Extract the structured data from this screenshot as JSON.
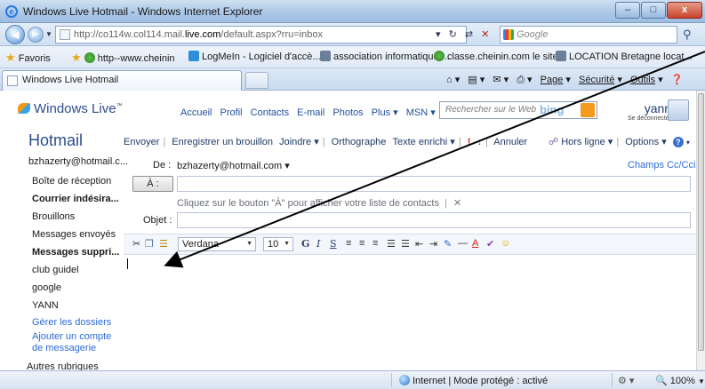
{
  "window": {
    "title": "Windows Live Hotmail - Windows Internet Explorer",
    "min": "–",
    "max": "□",
    "close": "x"
  },
  "address": {
    "url_prefix": "http://co114w.col114.mail.",
    "url_domain": "live.com",
    "url_suffix": "/default.aspx?rru=inbox",
    "search_placeholder": "Google",
    "back_icon": "back-arrow-icon",
    "forward_icon": "forward-arrow-icon"
  },
  "favorites": {
    "label": "Favoris",
    "items": [
      "http--www.cheinin",
      "LogMeIn - Logiciel d'accè...",
      "association informatique ...",
      "classe.cheinin.com  le site...",
      "LOCATION Bretagne locat..."
    ]
  },
  "tabs": {
    "active": "Windows Live Hotmail",
    "page": "Page",
    "security": "Sécurité",
    "tools": "Outils"
  },
  "header": {
    "brand": "Windows Live",
    "nav": [
      "Accueil",
      "Profil",
      "Contacts",
      "E-mail",
      "Photos",
      "Plus ▾",
      "MSN ▾"
    ],
    "search_placeholder": "Rechercher sur le Web",
    "search_engine": "bing",
    "user_name": "yann",
    "user_sub": "Se déconnecter"
  },
  "app": {
    "title": "Hotmail",
    "toolbar": [
      "Envoyer",
      "Enregistrer un brouillon",
      "Joindre ▾",
      "Orthographe",
      "Texte enrichi ▾",
      "Annuler"
    ],
    "offline": "Hors ligne ▾",
    "options": "Options ▾"
  },
  "sidebar": {
    "account": "bzhazerty@hotmail.c...",
    "items": [
      {
        "label": "Boîte de réception",
        "style": "normal"
      },
      {
        "label": "Courrier indésira...",
        "style": "bold"
      },
      {
        "label": "Brouillons",
        "style": "normal"
      },
      {
        "label": "Messages envoyés",
        "style": "normal"
      },
      {
        "label": "Messages suppri...",
        "style": "bold"
      },
      {
        "label": "club guidel",
        "style": "normal"
      },
      {
        "label": "google",
        "style": "normal"
      },
      {
        "label": "YANN",
        "style": "normal"
      },
      {
        "label": "Gérer les dossiers",
        "style": "link"
      },
      {
        "label": "Ajouter un compte",
        "style": "link"
      },
      {
        "label": "de messagerie",
        "style": "link"
      }
    ],
    "other": "Autres rubriques"
  },
  "compose": {
    "from_label": "De :",
    "from_value": "bzhazerty@hotmail.com ▾",
    "cc_link": "Champs Cc/Cci",
    "to_button": "À :",
    "hint": "Cliquez sur le bouton \"À\" pour afficher votre liste de contacts",
    "hint_close": "✕",
    "subject_label": "Objet :",
    "to_value": "",
    "subject_value": ""
  },
  "format": {
    "font": "Verdana",
    "size": "10",
    "bold": "G",
    "italic": "I",
    "underline": "S"
  },
  "status": {
    "zone": "Internet | Mode protégé : activé",
    "zoom": " 100%"
  },
  "colors": {
    "accent": "#2b6bd9",
    "brand": "#2b4d8c",
    "arrow": "#000000"
  }
}
